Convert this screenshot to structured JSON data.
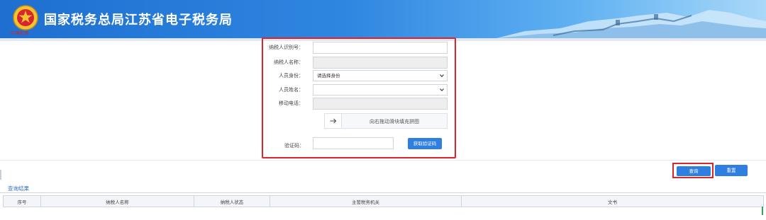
{
  "header": {
    "site_title": "国家税务总局江苏省电子税务局",
    "emblem_caption": "中国税务",
    "colors": {
      "banner_start": "#1e6fd0",
      "banner_end": "#a9d8f8"
    }
  },
  "form": {
    "taxpayer_id_label": "纳税人识别号：",
    "taxpayer_name_label": "纳税人名称：",
    "identity_label": "人员身份：",
    "identity_selected": "请选择身份",
    "person_name_label": "人员姓名：",
    "mobile_label": "移动电话：",
    "slider_text": "向右拖动滑块填充拼图",
    "captcha_label": "验证码：",
    "get_code_button": "获取验证码"
  },
  "actions": {
    "query_button": "查询",
    "reset_button": "重置"
  },
  "results": {
    "title": "查询结果",
    "columns": [
      "序号",
      "纳税人名称",
      "纳税人状态",
      "主管税务机关",
      "文书"
    ]
  },
  "colors": {
    "accent": "#2f7fe0",
    "highlight": "#d9262e"
  }
}
